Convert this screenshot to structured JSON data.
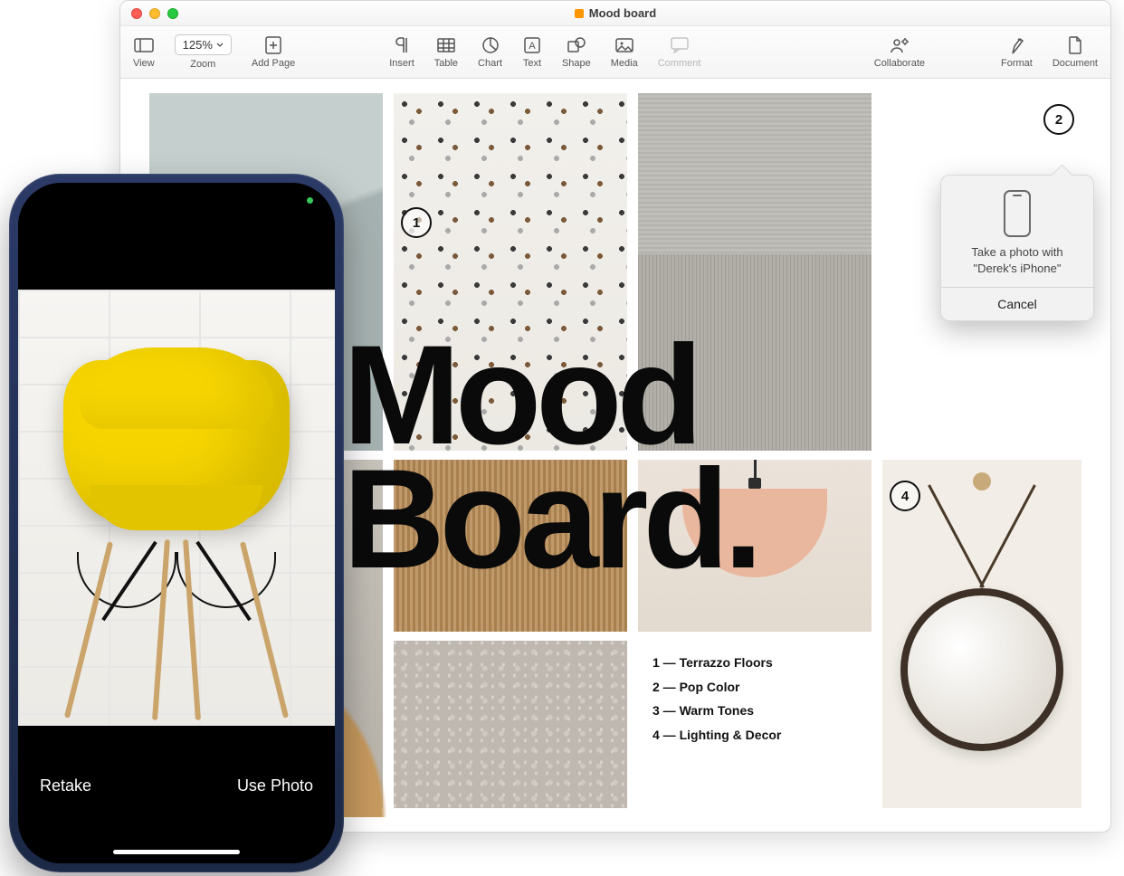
{
  "window": {
    "title": "Mood board"
  },
  "toolbar": {
    "view": {
      "label": "View"
    },
    "zoom": {
      "value": "125%",
      "label": "Zoom"
    },
    "addpage": {
      "label": "Add Page"
    },
    "insert": {
      "label": "Insert"
    },
    "table": {
      "label": "Table"
    },
    "chart": {
      "label": "Chart"
    },
    "text": {
      "label": "Text"
    },
    "shape": {
      "label": "Shape"
    },
    "media": {
      "label": "Media"
    },
    "comment": {
      "label": "Comment"
    },
    "collab": {
      "label": "Collaborate"
    },
    "format": {
      "label": "Format"
    },
    "document": {
      "label": "Document"
    }
  },
  "doc": {
    "heading_line1": "Mood",
    "heading_line2": "Board."
  },
  "legend": {
    "items": [
      {
        "num": "1",
        "text": "Terrazzo Floors"
      },
      {
        "num": "2",
        "text": "Pop Color"
      },
      {
        "num": "3",
        "text": "Warm Tones"
      },
      {
        "num": "4",
        "text": "Lighting & Decor"
      }
    ]
  },
  "badges": {
    "b1": "1",
    "b2": "2",
    "b4": "4"
  },
  "popover": {
    "line1": "Take a photo with",
    "line2": "\"Derek's iPhone\"",
    "cancel": "Cancel"
  },
  "phone": {
    "retake": "Retake",
    "usephoto": "Use Photo"
  }
}
